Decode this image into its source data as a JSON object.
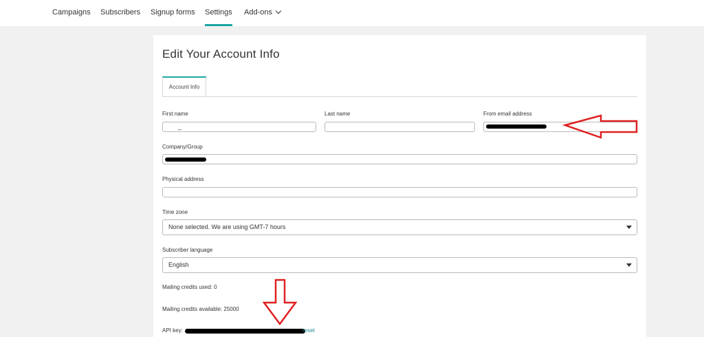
{
  "nav": {
    "items": [
      "Campaigns",
      "Subscribers",
      "Signup forms",
      "Settings",
      "Add-ons"
    ],
    "active": "Settings"
  },
  "page": {
    "title": "Edit Your Account Info",
    "tab": "Account Info"
  },
  "form": {
    "first_name_label": "First name",
    "first_name_value": "_",
    "last_name_label": "Last name",
    "last_name_value": "",
    "from_email_label": "From email address",
    "company_label": "Company/Group",
    "physical_address_label": "Physical address",
    "physical_address_value": "",
    "time_zone_label": "Time zone",
    "time_zone_value": "None selected. We are using GMT-7 hours",
    "subscriber_language_label": "Subscriber language",
    "subscriber_language_value": "English"
  },
  "account": {
    "credits_used_label": "Mailing credits used:",
    "credits_used_value": "0",
    "credits_available_label": "Mailing credits available:",
    "credits_available_value": "25000",
    "api_key_label": "API key:",
    "reset_link": "reset"
  },
  "colors": {
    "accent": "#1aa6a6",
    "annotation": "#e02020"
  }
}
